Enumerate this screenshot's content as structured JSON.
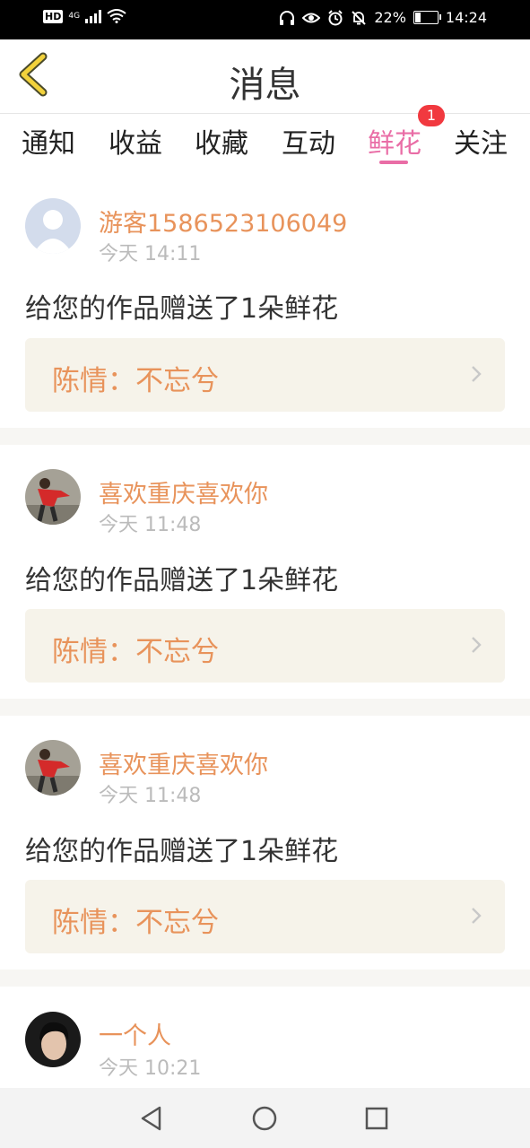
{
  "status_bar": {
    "hd": "HD",
    "network": "4G",
    "battery_percent": "22%",
    "battery_level": 0.22,
    "time": "14:24",
    "icons": [
      "headphones-icon",
      "eye-icon",
      "alarm-icon",
      "mute-bell-icon",
      "battery-icon"
    ]
  },
  "header": {
    "title": "消息"
  },
  "tabs": [
    {
      "label": "通知",
      "active": false
    },
    {
      "label": "收益",
      "active": false
    },
    {
      "label": "收藏",
      "active": false
    },
    {
      "label": "互动",
      "active": false
    },
    {
      "label": "鲜花",
      "active": true,
      "badge": "1"
    },
    {
      "label": "关注",
      "active": false
    }
  ],
  "messages": [
    {
      "username": "游客1586523106049",
      "time": "今天 14:11",
      "text": "给您的作品赠送了1朵鲜花",
      "work_title": "陈情：不忘兮"
    },
    {
      "username": "喜欢重庆喜欢你",
      "time": "今天 11:48",
      "text": "给您的作品赠送了1朵鲜花",
      "work_title": "陈情：不忘兮"
    },
    {
      "username": "喜欢重庆喜欢你",
      "time": "今天 11:48",
      "text": "给您的作品赠送了1朵鲜花",
      "work_title": "陈情：不忘兮"
    },
    {
      "username": "一个人",
      "time": "今天 10:21"
    }
  ],
  "colors": {
    "accent_pink": "#e96da6",
    "name_orange": "#e8935b",
    "badge_red": "#f1393f",
    "back_yellow": "#f2d23c"
  }
}
